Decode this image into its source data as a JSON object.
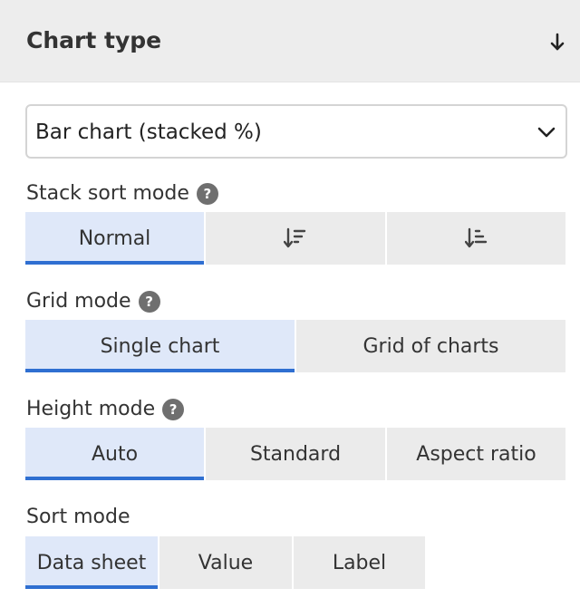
{
  "header": {
    "title": "Chart type",
    "collapse_icon": "arrow-down-icon"
  },
  "chart_type_select": {
    "value": "Bar chart (stacked %)",
    "icon": "chevron-down-icon"
  },
  "stack_sort": {
    "label": "Stack sort mode",
    "help": "?",
    "options": [
      {
        "label": "Normal",
        "active": true
      },
      {
        "icon": "sort-descending-icon",
        "active": false
      },
      {
        "icon": "sort-ascending-icon",
        "active": false
      }
    ]
  },
  "grid_mode": {
    "label": "Grid mode",
    "help": "?",
    "options": [
      {
        "label": "Single chart",
        "active": true
      },
      {
        "label": "Grid of charts",
        "active": false
      }
    ]
  },
  "height_mode": {
    "label": "Height mode",
    "help": "?",
    "options": [
      {
        "label": "Auto",
        "active": true
      },
      {
        "label": "Standard",
        "active": false
      },
      {
        "label": "Aspect ratio",
        "active": false
      }
    ]
  },
  "sort_mode": {
    "label": "Sort mode",
    "options": [
      {
        "label": "Data sheet",
        "active": true
      },
      {
        "label": "Value",
        "active": false
      },
      {
        "label": "Label",
        "active": false
      }
    ]
  },
  "colors": {
    "accent": "#2f6fd1",
    "active_bg": "#dfe8f9",
    "inactive_bg": "#ebebeb",
    "header_bg": "#ededed"
  }
}
